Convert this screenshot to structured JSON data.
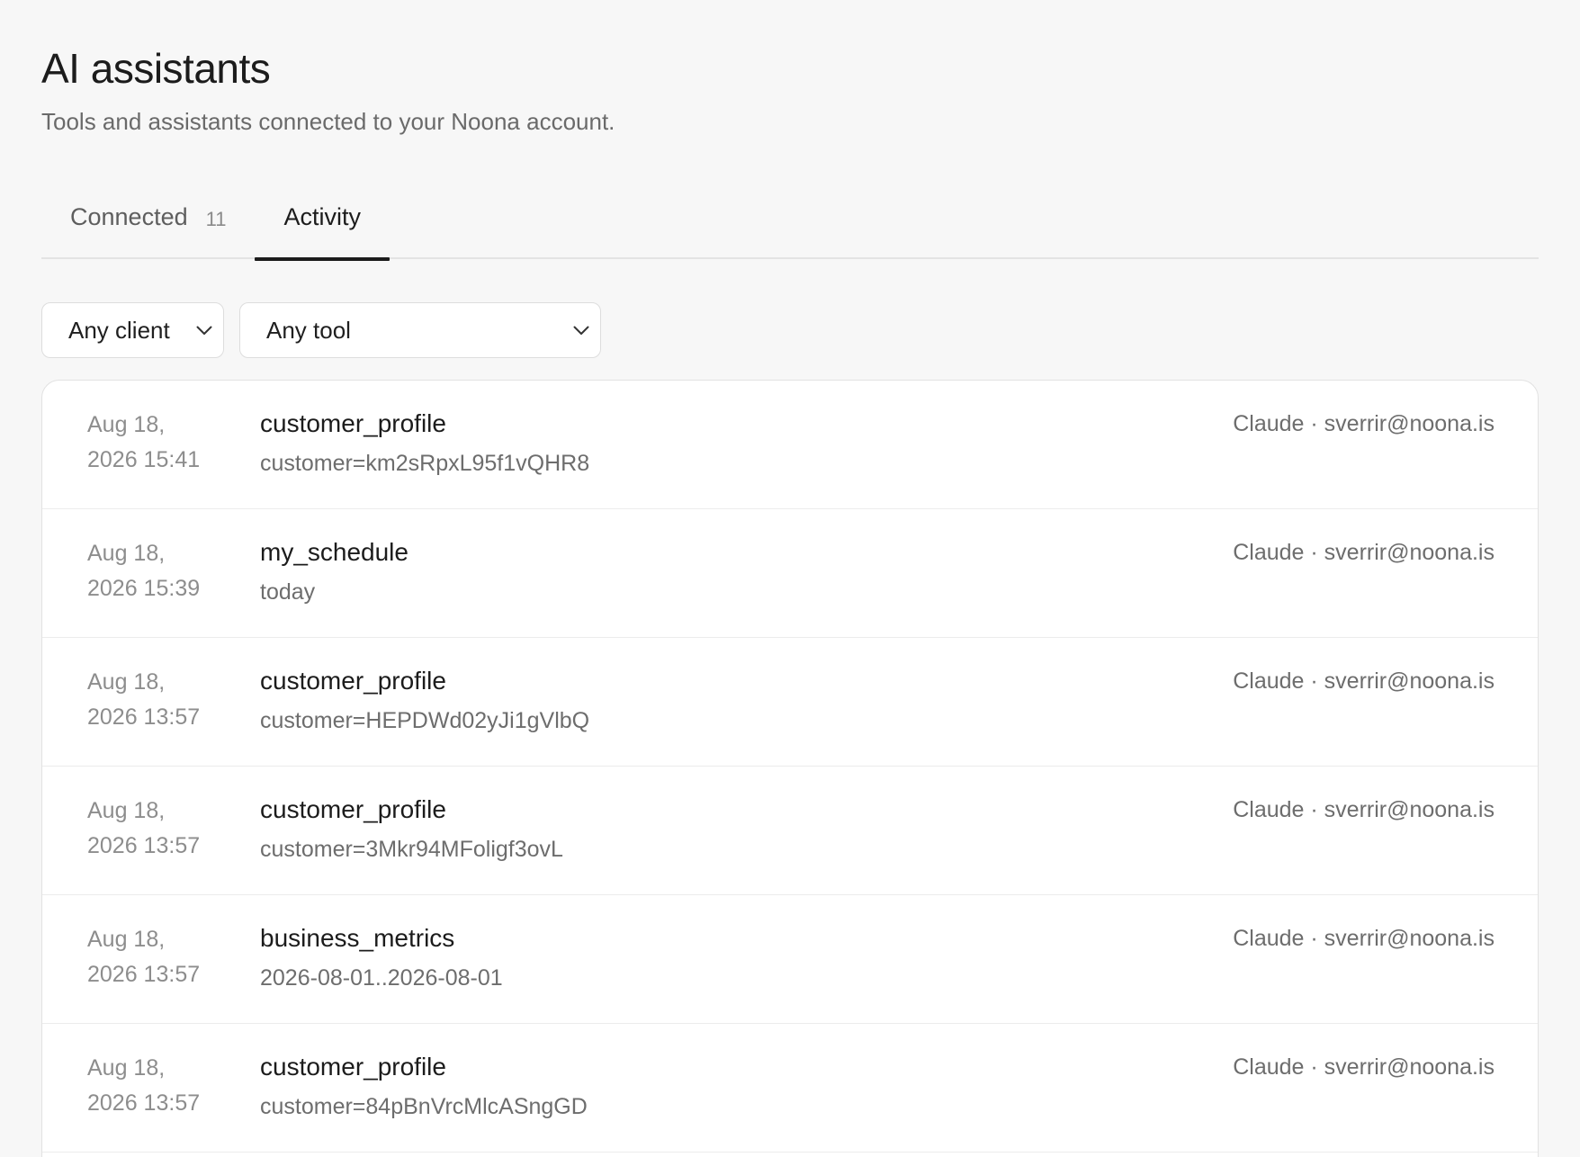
{
  "header": {
    "title": "AI assistants",
    "subtitle": "Tools and assistants connected to your Noona account."
  },
  "tabs": [
    {
      "label": "Connected",
      "count": "11",
      "active": false
    },
    {
      "label": "Activity",
      "count": "",
      "active": true
    }
  ],
  "filters": {
    "client": {
      "value": "Any client",
      "icon": "chevron-down-icon"
    },
    "tool": {
      "value": "Any tool",
      "icon": "chevron-down-icon"
    }
  },
  "activity": [
    {
      "date_line1": "Aug 18,",
      "date_line2": "2026 15:41",
      "tool": "customer_profile",
      "args": "customer=km2sRpxL95f1vQHR8",
      "meta": "Claude · sverrir@noona.is"
    },
    {
      "date_line1": "Aug 18,",
      "date_line2": "2026 15:39",
      "tool": "my_schedule",
      "args": "today",
      "meta": "Claude · sverrir@noona.is"
    },
    {
      "date_line1": "Aug 18,",
      "date_line2": "2026 13:57",
      "tool": "customer_profile",
      "args": "customer=HEPDWd02yJi1gVlbQ",
      "meta": "Claude · sverrir@noona.is"
    },
    {
      "date_line1": "Aug 18,",
      "date_line2": "2026 13:57",
      "tool": "customer_profile",
      "args": "customer=3Mkr94MFoligf3ovL",
      "meta": "Claude · sverrir@noona.is"
    },
    {
      "date_line1": "Aug 18,",
      "date_line2": "2026 13:57",
      "tool": "business_metrics",
      "args": "2026-08-01..2026-08-01",
      "meta": "Claude · sverrir@noona.is"
    },
    {
      "date_line1": "Aug 18,",
      "date_line2": "2026 13:57",
      "tool": "customer_profile",
      "args": "customer=84pBnVrcMlcASngGD",
      "meta": "Claude · sverrir@noona.is"
    }
  ]
}
